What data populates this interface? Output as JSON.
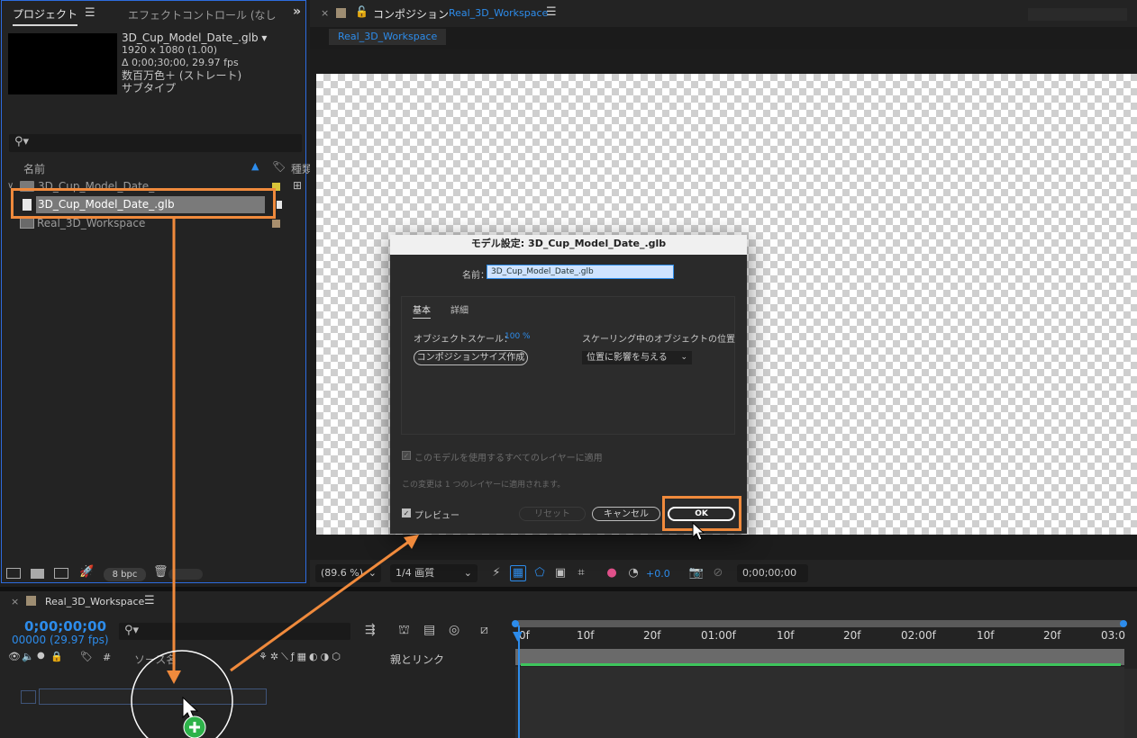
{
  "project_panel": {
    "tab_project": "プロジェクト",
    "tab_effects": "エフェクトコントロール (なし",
    "selected_item_name": "3D_Cup_Model_Date_.glb ▾",
    "item_resolution": "1920 x 1080 (1.00)",
    "item_duration": "Δ 0;00;30;00, 29.97 fps",
    "item_color": "数百万色＋ (ストレート)",
    "item_subtype": "サブタイプ",
    "col_name": "名前",
    "col_type": "種類",
    "rows": [
      {
        "label": "3D_Cup_Model_Date_"
      },
      {
        "label": "3D_Cup_Model_Date_.glb"
      },
      {
        "label": "Real_3D_Workspace"
      }
    ],
    "bpc_label": "8 bpc"
  },
  "comp_panel": {
    "title_prefix": "コンポジション",
    "comp_name": "Real_3D_Workspace",
    "crumb_label": "Real_3D_Workspace",
    "zoom": "(89.6 %)",
    "quality": "1/4 画質",
    "exposure": "+0.0",
    "timecode": "0;00;00;00"
  },
  "dialog": {
    "title": "モデル設定: 3D_Cup_Model_Date_.glb",
    "name_label": "名前：",
    "name_value": "3D_Cup_Model_Date_.glb",
    "tab_basic": "基本",
    "tab_detail": "詳細",
    "scale_label": "オブジェクトスケール：",
    "scale_value": "100 %",
    "position_label": "スケーリング中のオブジェクトの位置",
    "fit_comp_button": "コンポジションサイズ作成",
    "position_select": "位置に影響を与える",
    "apply_all_label": "このモデルを使用するすべてのレイヤーに適用",
    "apply_note": "この変更は 1 つのレイヤーに適用されます。",
    "preview_label": "プレビュー",
    "reset_button": "リセット",
    "cancel_button": "キャンセル",
    "ok_button": "OK"
  },
  "timeline": {
    "tab_label": "Real_3D_Workspace",
    "timecode": "0;00;00;00",
    "frame_info": "00000 (29.97 fps)",
    "col_source": "ソース名",
    "col_parent": "親とリンク",
    "col_hash": "#",
    "ruler_labels": [
      "0f",
      "10f",
      "20f",
      "01:00f",
      "10f",
      "20f",
      "02:00f",
      "10f",
      "20f",
      "03:0"
    ]
  },
  "colors": {
    "accent": "#2d8ceb",
    "highlight": "#f08a3c",
    "green": "#3ec55c"
  }
}
